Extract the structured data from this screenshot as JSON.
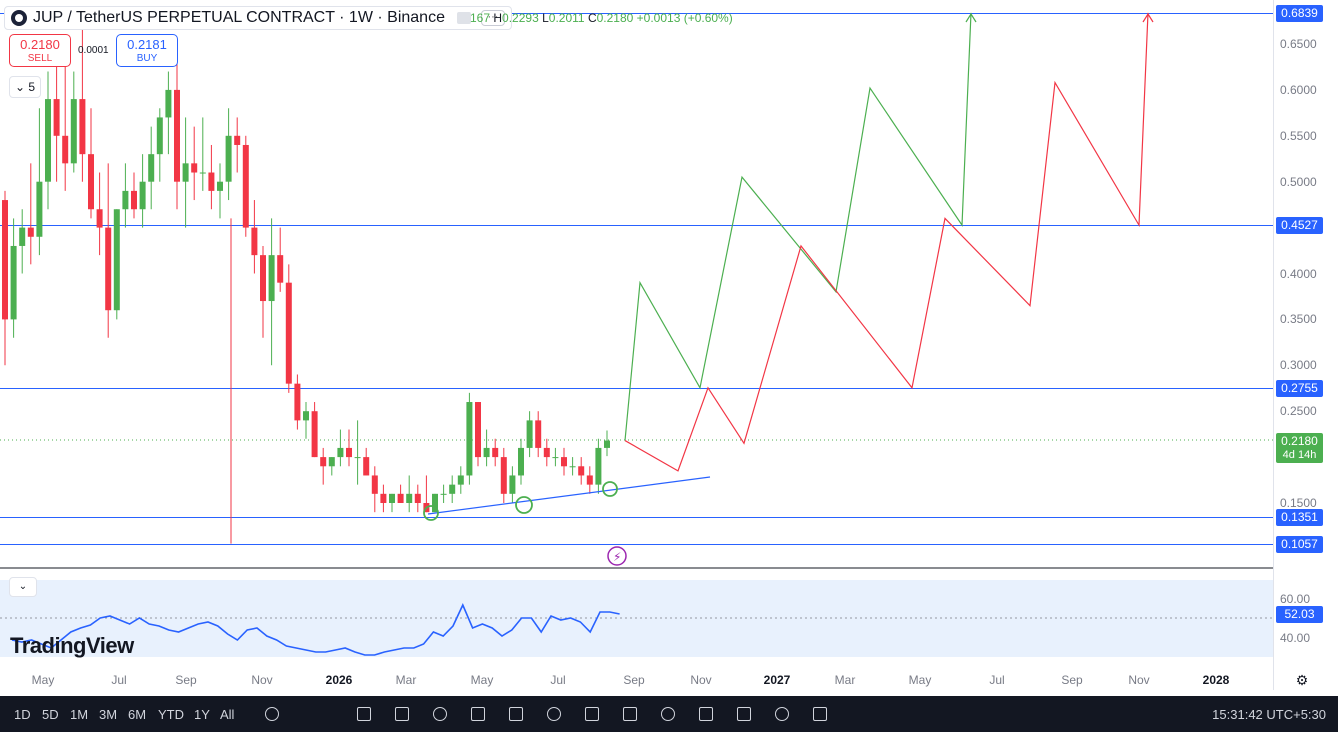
{
  "header": {
    "symbol_title": "JUP / TetherUS PERPETUAL CONTRACT · 1W · Binance",
    "ohlc": {
      "open_partial": "167",
      "h_label": "H",
      "high": "0.2293",
      "l_label": "L",
      "low": "0.2011",
      "c_label": "C",
      "close": "0.2180",
      "change": "+0.0013 (+0.60%)"
    }
  },
  "trade": {
    "sell_price": "0.2180",
    "sell_label": "SELL",
    "spread": "0.0001",
    "buy_price": "0.2181",
    "buy_label": "BUY",
    "interval_indicator": "5"
  },
  "price_axis": {
    "ticks": [
      "0.6500",
      "0.6000",
      "0.5500",
      "0.5000",
      "0.4000",
      "0.3500",
      "0.3000",
      "0.2500",
      "0.1500"
    ],
    "badges": [
      {
        "label": "0.6839"
      },
      {
        "label": "0.4527"
      },
      {
        "label": "0.2755"
      },
      {
        "label": "0.1351"
      },
      {
        "label": "0.1057"
      }
    ],
    "current_price": "0.2180",
    "countdown": "4d 14h"
  },
  "horizontal_levels": [
    0.6839,
    0.4527,
    0.2755,
    0.1351,
    0.1057
  ],
  "time_axis": {
    "labels": [
      {
        "text": "May",
        "year": false
      },
      {
        "text": "Jul",
        "year": false
      },
      {
        "text": "Sep",
        "year": false
      },
      {
        "text": "Nov",
        "year": false
      },
      {
        "text": "2026",
        "year": true
      },
      {
        "text": "Mar",
        "year": false
      },
      {
        "text": "May",
        "year": false
      },
      {
        "text": "Jul",
        "year": false
      },
      {
        "text": "Sep",
        "year": false
      },
      {
        "text": "Nov",
        "year": false
      },
      {
        "text": "2027",
        "year": true
      },
      {
        "text": "Mar",
        "year": false
      },
      {
        "text": "May",
        "year": false
      },
      {
        "text": "Jul",
        "year": false
      },
      {
        "text": "Sep",
        "year": false
      },
      {
        "text": "Nov",
        "year": false
      },
      {
        "text": "2028",
        "year": true
      }
    ]
  },
  "rsi": {
    "toggle": "⌄",
    "ticks": [
      "60.00",
      "40.00"
    ],
    "current": "52.03"
  },
  "watermark": "TradingView",
  "bottom_bar": {
    "ranges": [
      "1D",
      "5D",
      "1M",
      "3M",
      "6M",
      "YTD",
      "1Y",
      "All"
    ],
    "clock": "15:31:42 UTC+5:30"
  },
  "colors": {
    "up": "#26a69a",
    "green": "#4caf50",
    "down": "#f23645",
    "level": "#2962ff",
    "projection_green": "#4caf50",
    "projection_red": "#f23645",
    "rsi": "#2962ff"
  },
  "projections": {
    "green_path": [
      0.218,
      0.39,
      0.2755,
      0.505,
      0.38,
      0.602,
      0.4527,
      0.6839
    ],
    "red_path": [
      0.218,
      0.185,
      0.2755,
      0.215,
      0.43,
      0.2755,
      0.46,
      0.365,
      0.608,
      0.4527,
      0.6839
    ]
  }
}
